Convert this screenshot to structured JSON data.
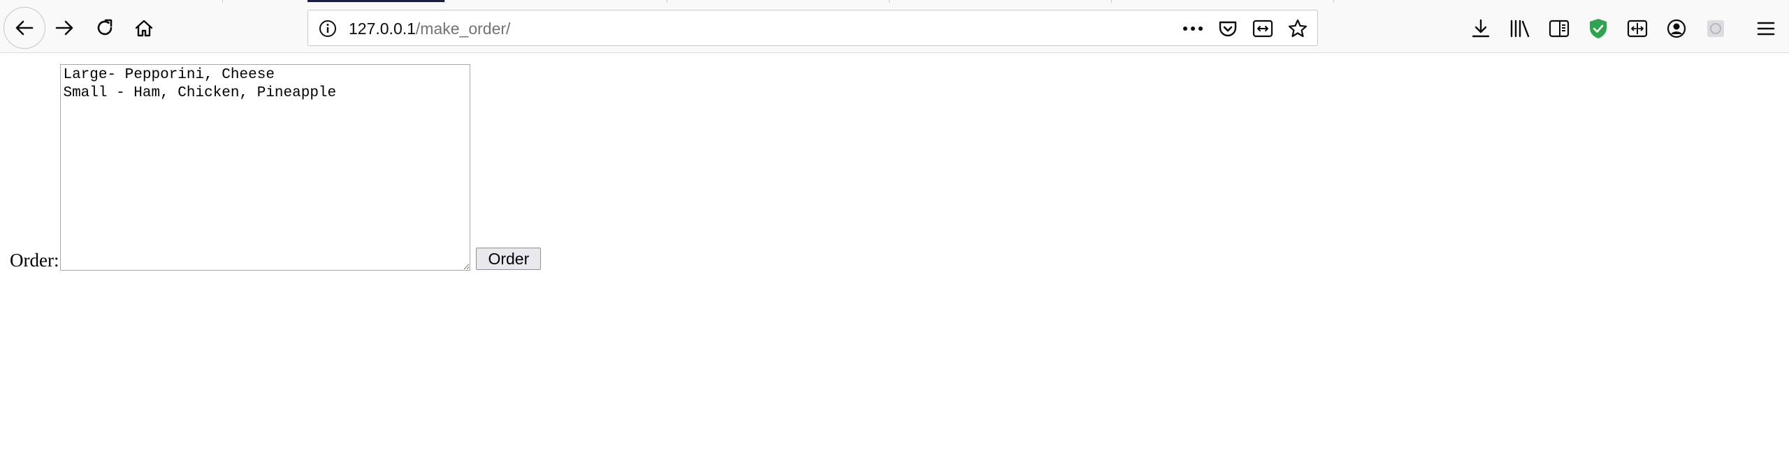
{
  "browser": {
    "url_host": "127.0.0.1",
    "url_path": "/make_order/",
    "icons": {
      "back": "back-arrow-icon",
      "forward": "forward-arrow-icon",
      "reload": "reload-icon",
      "home": "home-icon",
      "site_info": "info-icon",
      "page_actions": "more-dots-icon",
      "pocket": "pocket-icon",
      "reader": "reader-view-icon",
      "bookmark": "star-icon",
      "downloads": "download-icon",
      "library": "library-icon",
      "sidebar": "sidebar-icon",
      "shield": "shield-extension-icon",
      "container": "container-icon",
      "account": "account-icon",
      "extension": "extension-icon",
      "menu": "hamburger-menu-icon"
    },
    "shield_color": "#2ea44f"
  },
  "form": {
    "label": "Order:",
    "textarea_value": "Large- Pepporini, Cheese\nSmall - Ham, Chicken, Pineapple",
    "button_label": "Order"
  }
}
